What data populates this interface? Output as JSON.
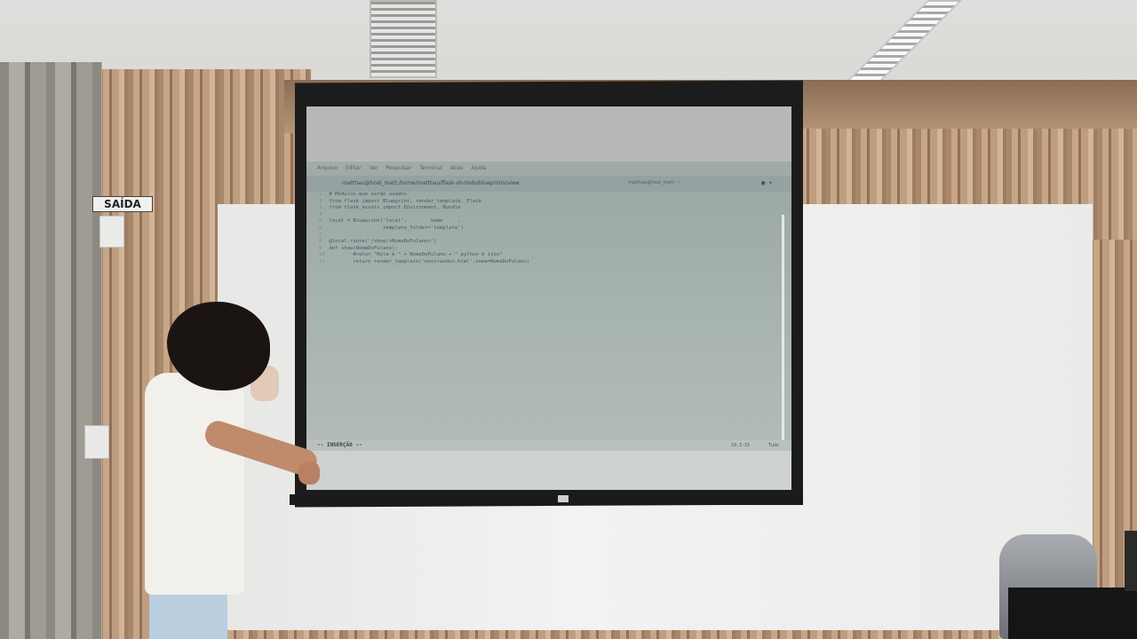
{
  "exit_sign": "SAÍDA",
  "projection": {
    "window_title": "matthau@host_matt:/home/matthau/flask-oh-todo/blueprints/view",
    "menu": [
      "Arquivo",
      "Editar",
      "Ver",
      "Pesquisar",
      "Terminal",
      "Abas",
      "Ajuda"
    ],
    "tab_right": "matthau@host_matt: ~",
    "code_lines": [
      {
        "n": "1",
        "text": "# Módulos que serão usados"
      },
      {
        "n": "2",
        "text": "from flask import Blueprint, render_template, Flask"
      },
      {
        "n": "3",
        "text": "from flask_assets import Environment, Bundle"
      },
      {
        "n": "4",
        "text": ""
      },
      {
        "n": "5",
        "text": "local = Blueprint('local',        name     ,"
      },
      {
        "n": "6",
        "text": "                  template_folder='template')"
      },
      {
        "n": "7",
        "text": ""
      },
      {
        "n": "8",
        "text": "@local.route('/show/<NomeDoFulano>')"
      },
      {
        "n": "9",
        "text": "def show(NomeDoFulano):"
      },
      {
        "n": "10",
        "text": "        #retur \"Hola é \" + NomeDoFulano + \" python é isso\""
      },
      {
        "n": "11",
        "text": "        return render_template('mostrandoo.html',nome=NomeDoFulano)"
      }
    ],
    "status_mode": "-- INSERÇÃO --",
    "cursor_pos": "10,3-15",
    "scroll_pos": "Tudo"
  },
  "colors": {
    "wood": "#b8967a",
    "wall": "#eeeeec",
    "screen_frame": "#1c1c1c",
    "terminal_bg": "#a3afad"
  }
}
